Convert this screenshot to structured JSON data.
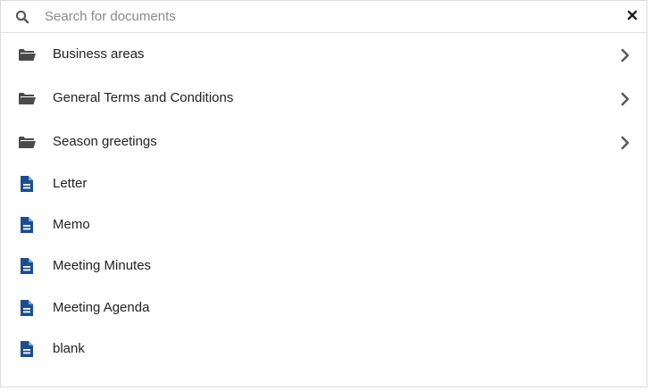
{
  "search": {
    "placeholder": "Search for documents",
    "value": ""
  },
  "folders": [
    {
      "label": "Business areas",
      "icon": "folder-open-icon"
    },
    {
      "label": "General Terms and Conditions",
      "icon": "folder-open-icon"
    },
    {
      "label": "Season greetings",
      "icon": "folder-open-icon"
    }
  ],
  "documents": [
    {
      "label": "Letter",
      "icon": "document-icon"
    },
    {
      "label": "Memo",
      "icon": "document-icon"
    },
    {
      "label": "Meeting Minutes",
      "icon": "document-icon"
    },
    {
      "label": "Meeting Agenda",
      "icon": "document-icon"
    },
    {
      "label": "blank",
      "icon": "document-icon"
    }
  ],
  "colors": {
    "folder": "#4a4a4a",
    "document": "#1a4f8f",
    "chevron": "#5a5a5a"
  }
}
